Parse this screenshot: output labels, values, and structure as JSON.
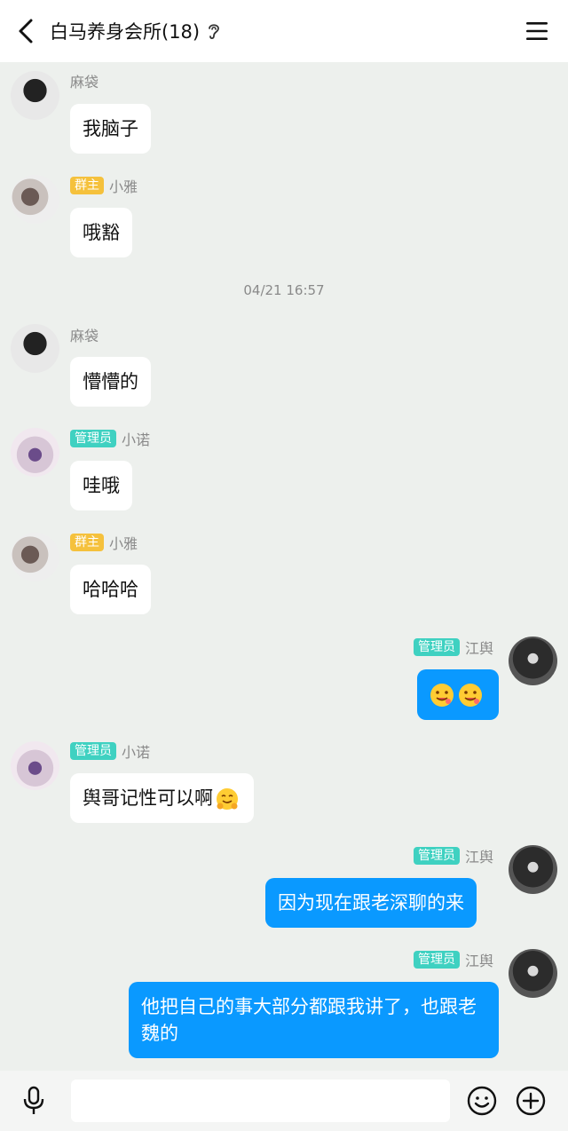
{
  "header": {
    "title": "白马养身会所(18)",
    "back_icon": "chevron-left-icon",
    "ear_icon": "ear-icon",
    "menu_icon": "hamburger-menu-icon"
  },
  "timestamp": "04/21 16:57",
  "roles": {
    "owner": "群主",
    "admin": "管理员"
  },
  "messages": [
    {
      "sender": "麻袋",
      "side": "left",
      "text": "我脑子"
    },
    {
      "sender": "小雅",
      "side": "left",
      "role": "群主",
      "text": "哦豁"
    },
    {
      "sender": "麻袋",
      "side": "left",
      "text": "懵懵的"
    },
    {
      "sender": "小诺",
      "side": "left",
      "role": "管理员",
      "text": "哇哦"
    },
    {
      "sender": "小雅",
      "side": "left",
      "role": "群主",
      "text": "哈哈哈"
    },
    {
      "sender": "江舆",
      "side": "right",
      "role": "管理员",
      "text": "",
      "emojis": [
        "drooling-face-emoji",
        "drooling-face-emoji"
      ]
    },
    {
      "sender": "小诺",
      "side": "left",
      "role": "管理员",
      "text": "舆哥记性可以啊",
      "emojis": [
        "hugging-face-emoji"
      ]
    },
    {
      "sender": "江舆",
      "side": "right",
      "role": "管理员",
      "text": "因为现在跟老深聊的来"
    },
    {
      "sender": "江舆",
      "side": "right",
      "role": "管理员",
      "text": "他把自己的事大部分都跟我讲了，也跟老魏的"
    }
  ],
  "inputbar": {
    "placeholder": "",
    "mic_icon": "microphone-icon",
    "emoji_icon": "smiley-face-icon",
    "plus_icon": "plus-circle-icon"
  },
  "colors": {
    "background": "#edf0ed",
    "outgoing_bubble": "#0a99ff",
    "owner_badge": "#f5c13c",
    "admin_badge": "#3fd1c1"
  }
}
